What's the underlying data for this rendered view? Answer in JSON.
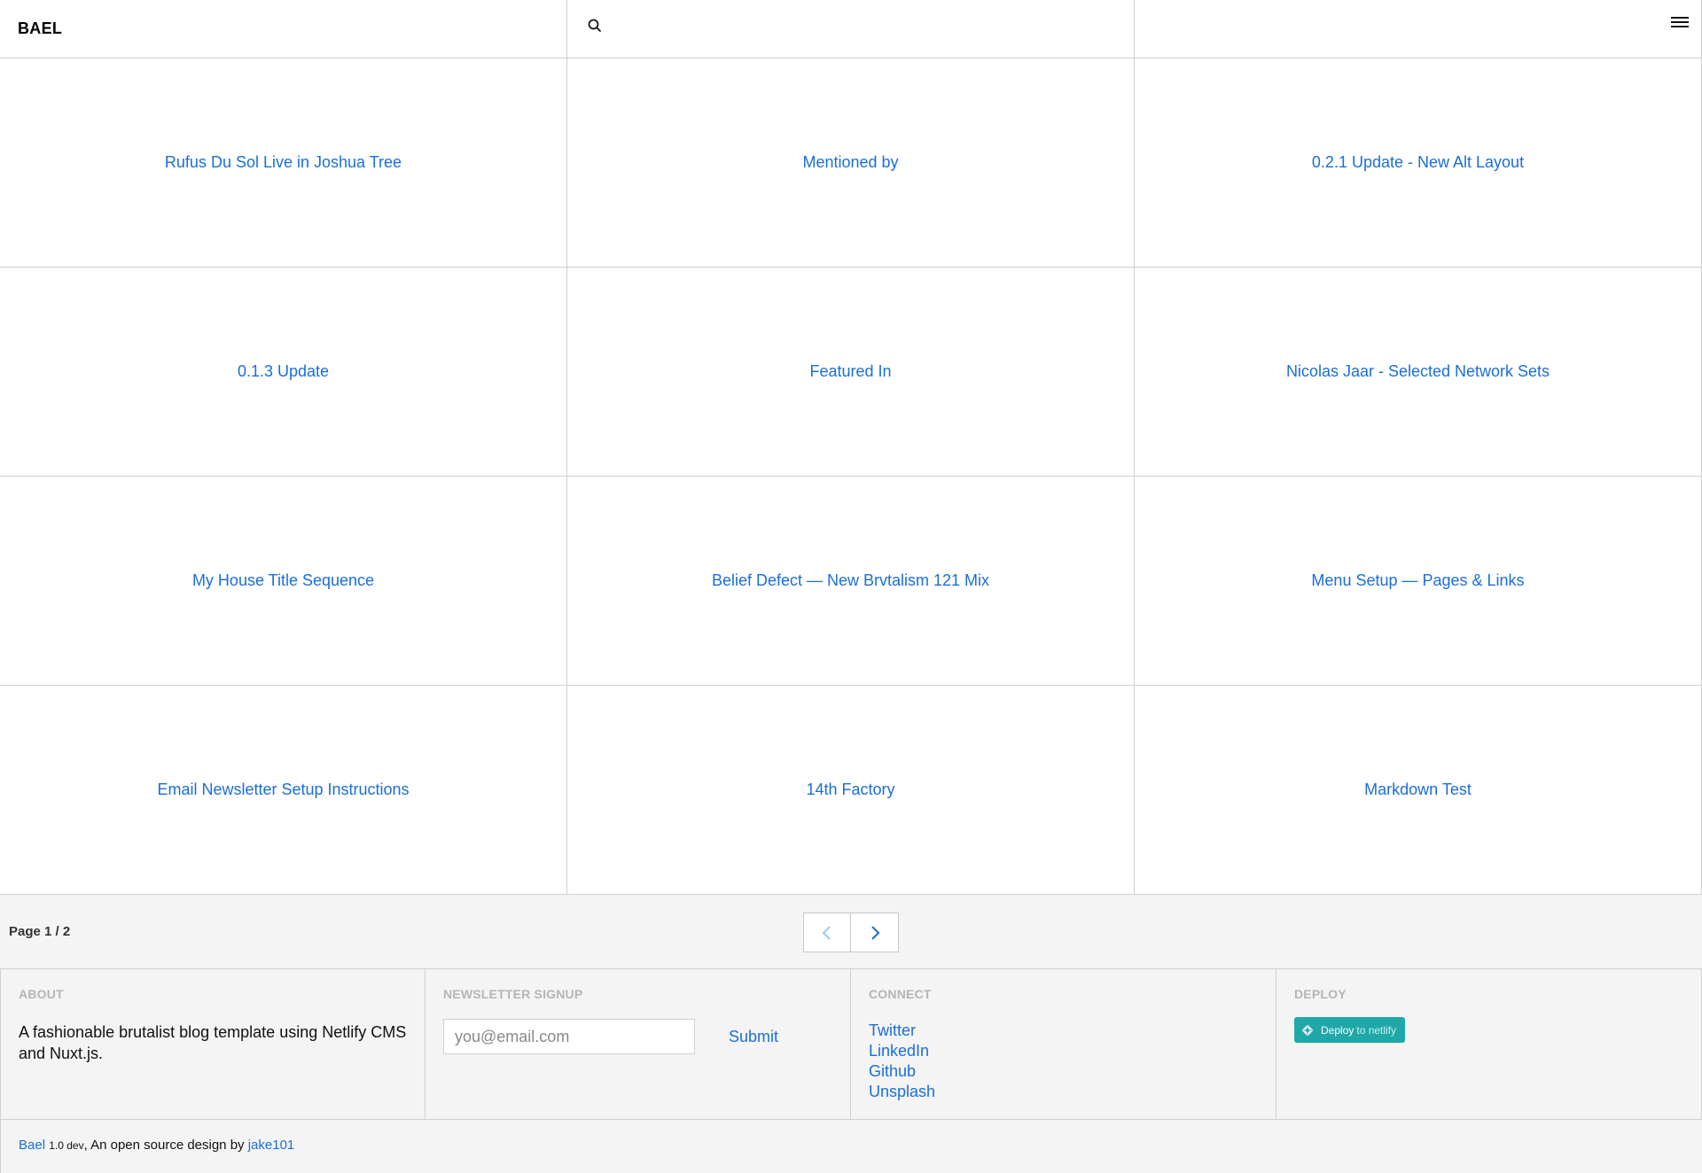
{
  "header": {
    "logo": "BAEL",
    "icons": {
      "search": "search-icon",
      "menu": "hamburger-menu-icon"
    }
  },
  "posts": [
    {
      "title": "Rufus Du Sol Live in Joshua Tree"
    },
    {
      "title": "Mentioned by"
    },
    {
      "title": "0.2.1 Update - New Alt Layout"
    },
    {
      "title": "0.1.3 Update"
    },
    {
      "title": "Featured In"
    },
    {
      "title": "Nicolas Jaar - Selected Network Sets"
    },
    {
      "title": "My House Title Sequence"
    },
    {
      "title": "Belief Defect — New Brvtalism 121 Mix"
    },
    {
      "title": "Menu Setup — Pages & Links"
    },
    {
      "title": "Email Newsletter Setup Instructions"
    },
    {
      "title": "14th Factory"
    },
    {
      "title": "Markdown Test"
    }
  ],
  "pagination": {
    "label": "Page 1 / 2",
    "prev_icon": "chevron-left-icon",
    "next_icon": "chevron-right-icon"
  },
  "footer": {
    "about": {
      "heading": "About",
      "text": "A fashionable brutalist blog template using Netlify CMS and Nuxt.js."
    },
    "newsletter": {
      "heading": "Newsletter Signup",
      "placeholder": "you@email.com",
      "value": "",
      "submit_label": "Submit"
    },
    "connect": {
      "heading": "Connect",
      "links": [
        "Twitter",
        "LinkedIn",
        "Github",
        "Unsplash"
      ]
    },
    "deploy": {
      "heading": "Deploy",
      "button_label": "Deploy",
      "button_suffix": "to netlify"
    }
  },
  "credits": {
    "name": "Bael",
    "version": "1.0 dev",
    "text": ", An open source design by",
    "author": "jake101"
  },
  "colors": {
    "link": "#1a6ed8",
    "border": "#d0d0d0",
    "footer_bg": "#f4f4f4",
    "heading_muted": "#b5b5b5",
    "netlify_teal": "#20a8a8"
  }
}
